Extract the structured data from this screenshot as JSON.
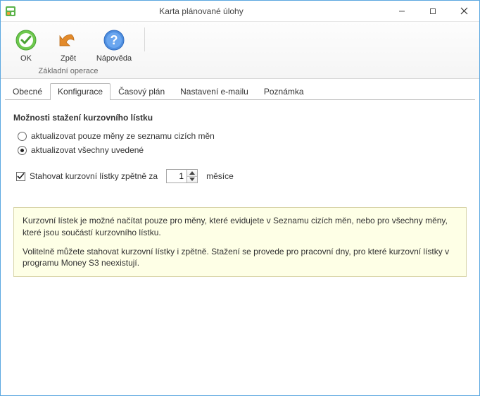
{
  "window": {
    "title": "Karta plánované úlohy"
  },
  "ribbon": {
    "ok_label": "OK",
    "back_label": "Zpět",
    "help_label": "Nápověda",
    "group_label": "Základní operace"
  },
  "tabs": {
    "items": [
      {
        "label": "Obecné"
      },
      {
        "label": "Konfigurace"
      },
      {
        "label": "Časový plán"
      },
      {
        "label": "Nastavení e-mailu"
      },
      {
        "label": "Poznámka"
      }
    ],
    "active_index": 1
  },
  "config": {
    "section_title": "Možnosti stažení kurzovního lístku",
    "radio_update_only": "aktualizovat pouze měny ze seznamu cizích měn",
    "radio_update_all": "aktualizovat všechny uvedené",
    "radio_selected": "all",
    "checkbox_label": "Stahovat kurzovní lístky zpětně za",
    "checkbox_checked": true,
    "months_value": "1",
    "months_unit": "měsíce",
    "info_p1": "Kurzovní lístek je možné načítat pouze pro měny, které evidujete v Seznamu cizích měn, nebo pro všechny měny, které jsou součástí kurzovního lístku.",
    "info_p2": "Volitelně můžete stahovat kurzovní lístky i zpětně. Stažení se provede pro pracovní dny, pro které kurzovní lístky v programu Money S3 neexistují."
  }
}
